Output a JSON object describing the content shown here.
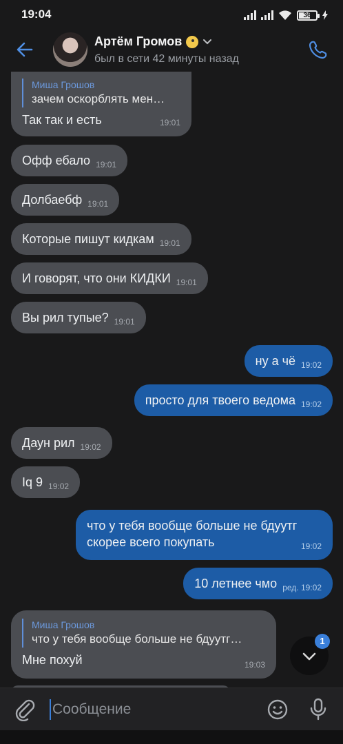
{
  "status": {
    "time": "19:04",
    "battery": "36"
  },
  "header": {
    "title": "Артём Громов",
    "subtitle": "был в сети 42 минуты назад"
  },
  "messages": [
    {
      "dir": "in",
      "reply_name": "Миша Грошов",
      "reply_text": "зачем оскорблять мен…",
      "text": "Так так и есть",
      "time": "19:01"
    },
    {
      "dir": "in",
      "text": "Офф ебало",
      "time": "19:01"
    },
    {
      "dir": "in",
      "text": "Долбаебф",
      "time": "19:01"
    },
    {
      "dir": "in",
      "text": "Которые пишут кидкам",
      "time": "19:01"
    },
    {
      "dir": "in",
      "text": "И говорят, что они КИДКИ",
      "time": "19:01"
    },
    {
      "dir": "in",
      "text": "Вы рил тупые?",
      "time": "19:01"
    },
    {
      "dir": "out",
      "text": "ну а чё",
      "time": "19:02"
    },
    {
      "dir": "out",
      "text": "просто для твоего ведома",
      "time": "19:02"
    },
    {
      "dir": "in",
      "text": "Даун рил",
      "time": "19:02"
    },
    {
      "dir": "in",
      "text": "Iq 9",
      "time": "19:02"
    },
    {
      "dir": "out",
      "text_line1": "что у тебя вообще больше не бдуутг",
      "text_line2": "скорее всего покупать",
      "time": "19:02"
    },
    {
      "dir": "out",
      "text": "10 летнее чмо",
      "time": "ред. 19:02"
    },
    {
      "dir": "in",
      "reply_name": "Миша Грошов",
      "reply_text": "что у тебя вообще больше не бдуутг…",
      "text": "Мне похуй",
      "time": "19:03"
    }
  ],
  "scroll_down": {
    "badge": "1"
  },
  "composer": {
    "placeholder": "Сообщение"
  }
}
